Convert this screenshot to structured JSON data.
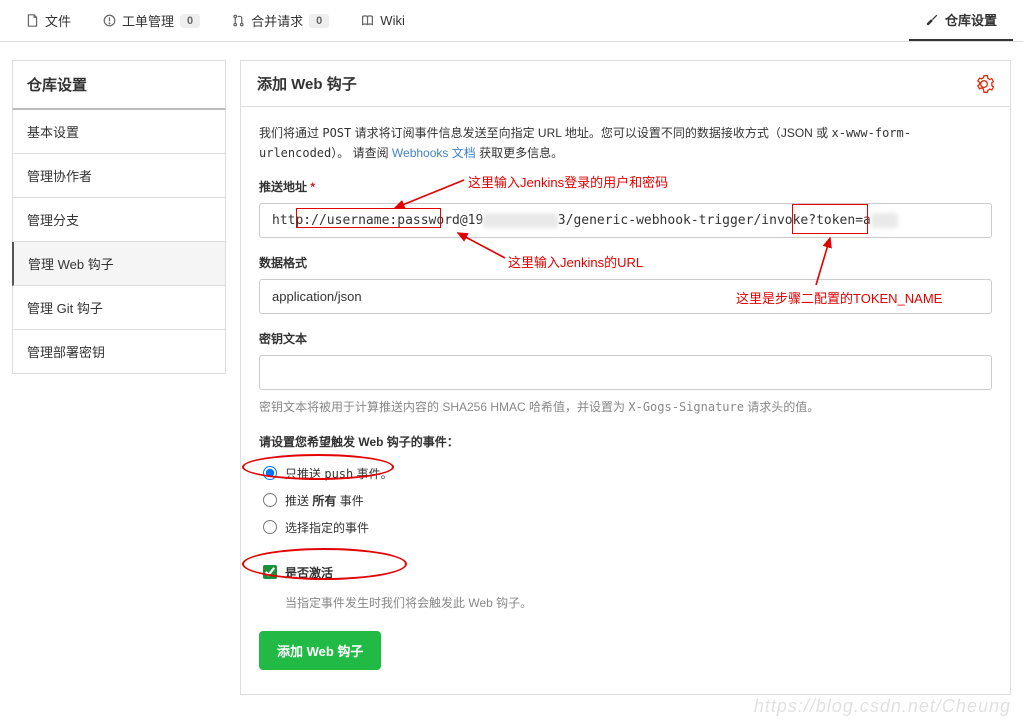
{
  "topNav": {
    "file": "文件",
    "issues": "工单管理",
    "issuesCount": "0",
    "pr": "合并请求",
    "prCount": "0",
    "wiki": "Wiki",
    "settings": "仓库设置"
  },
  "sidebar": {
    "title": "仓库设置",
    "items": [
      "基本设置",
      "管理协作者",
      "管理分支",
      "管理 Web 钩子",
      "管理 Git 钩子",
      "管理部署密钥"
    ]
  },
  "panel": {
    "title": "添加 Web 钩子",
    "intro1": "我们将通过 ",
    "introCode1": "POST",
    "intro2": " 请求将订阅事件信息发送至向指定 URL 地址。您可以设置不同的数据接收方式（JSON 或 ",
    "introCode2": "x-www-form-urlencoded",
    "intro3": "）。 请查阅 ",
    "introLink": "Webhooks 文档",
    "intro4": " 获取更多信息。"
  },
  "fields": {
    "urlLabel": "推送地址",
    "urlPrefix": "http://",
    "urlUser": "username:password",
    "urlAt": "@19",
    "urlBlur1": "xxxxxxxxx",
    "urlMid": "3/generic-webhook-trigger/invoke?token=a",
    "urlBlur2": "xxx",
    "formatLabel": "数据格式",
    "formatValue": "application/json",
    "secretLabel": "密钥文本",
    "secretValue": "",
    "secretHint1": "密钥文本将被用于计算推送内容的 SHA256 HMAC 哈希值，并设置为 ",
    "secretHintCode": "X-Gogs-Signature",
    "secretHint2": " 请求头的值。",
    "eventsTitle": "请设置您希望触发 Web 钩子的事件：",
    "radio1a": "只推送 ",
    "radio1b": "push",
    "radio1c": " 事件。",
    "radio2a": "推送 ",
    "radio2b": "所有",
    "radio2c": " 事件",
    "radio3": "选择指定的事件",
    "activeLabel": "是否激活",
    "activeHint": "当指定事件发生时我们将会触发此 Web 钩子。",
    "submit": "添加 Web 钩子"
  },
  "annotations": {
    "a1": "这里输入Jenkins登录的用户和密码",
    "a2": "这里输入Jenkins的URL",
    "a3": "这里是步骤二配置的TOKEN_NAME"
  },
  "watermark": "https://blog.csdn.net/Cheung"
}
